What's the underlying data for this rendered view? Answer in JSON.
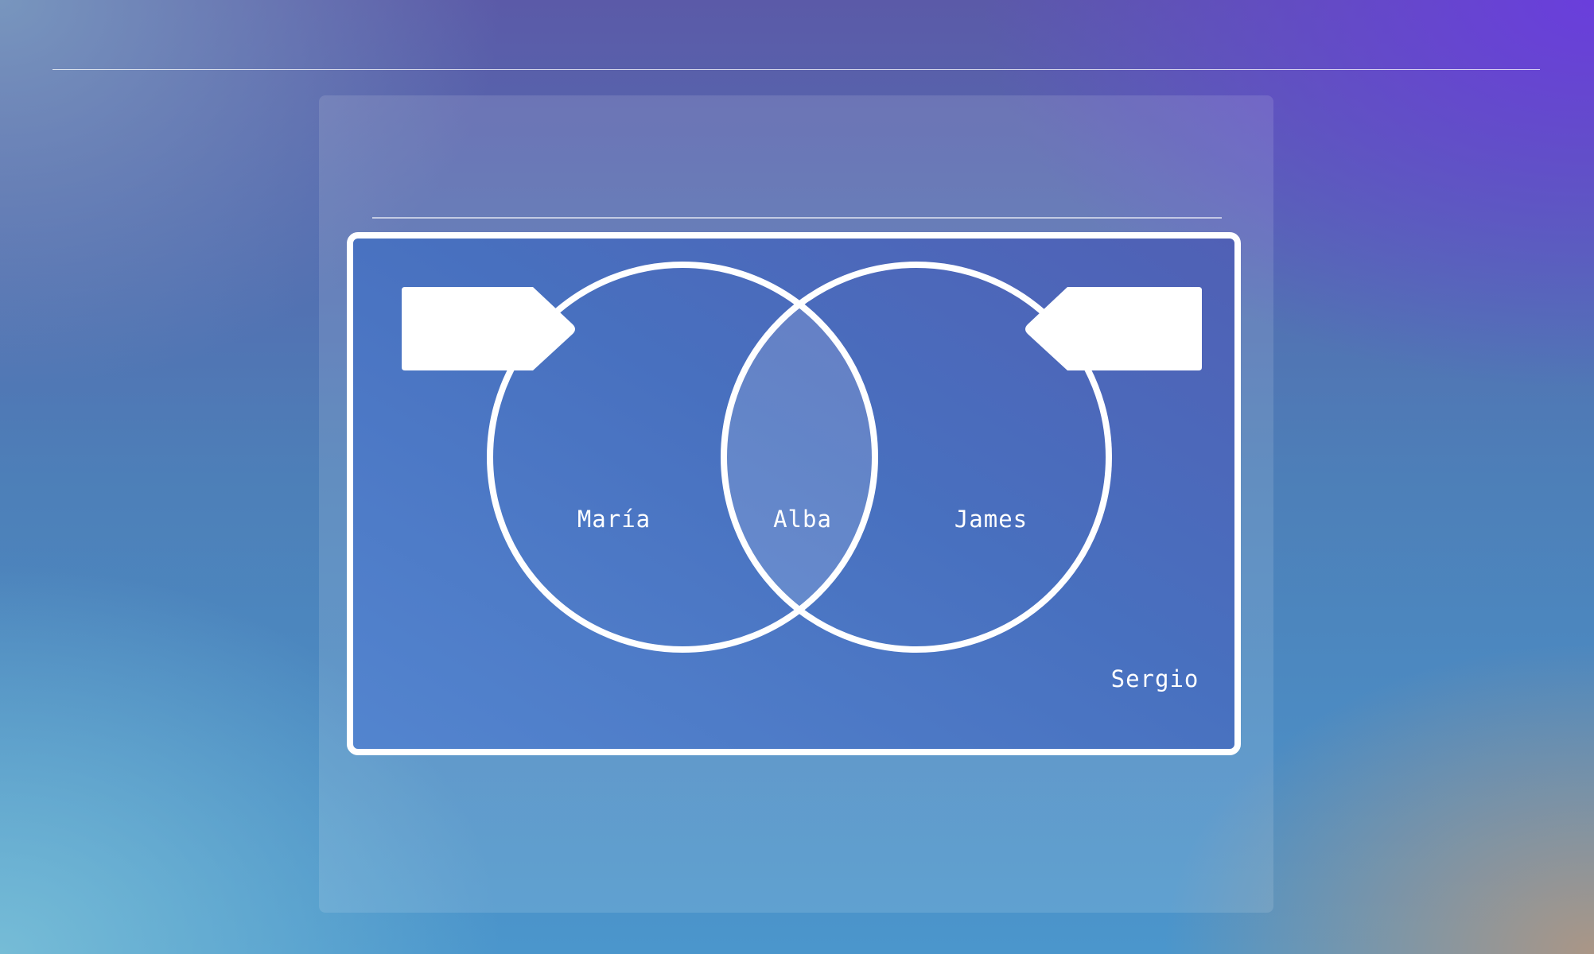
{
  "diagram": {
    "type": "venn",
    "regions": {
      "left_only": "María",
      "intersection": "Alba",
      "right_only": "James",
      "outside": "Sergio"
    },
    "tags": {
      "left": "",
      "right": ""
    },
    "colors": {
      "stroke": "#ffffff",
      "frame_fill": "#4c6fbf",
      "intersection_fill": "rgba(255,255,255,0.15)"
    }
  }
}
